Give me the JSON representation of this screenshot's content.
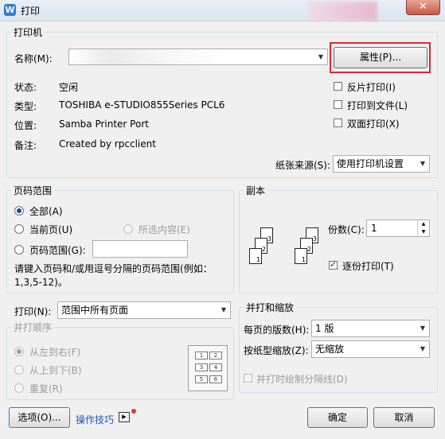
{
  "window": {
    "title": "打印",
    "close_symbol": "✕"
  },
  "printer": {
    "group_label": "打印机",
    "name_label": "名称(M):",
    "properties_button": "属性(P)...",
    "status_label": "状态:",
    "status_value": "空闲",
    "type_label": "类型:",
    "type_value": "TOSHIBA e-STUDIO855Series PCL6",
    "where_label": "位置:",
    "where_value": "Samba Printer Port",
    "comment_label": "备注:",
    "comment_value": "Created by rpcclient",
    "reverse_print": "反片打印(I)",
    "print_to_file": "打印到文件(L)",
    "duplex": "双面打印(X)",
    "paper_source_label": "纸张来源(S):",
    "paper_source_value": "使用打印机设置"
  },
  "page_range": {
    "group_label": "页码范围",
    "all": "全部(A)",
    "current": "当前页(U)",
    "selection": "所选内容(E)",
    "pages": "页码范围(G):",
    "hint": "请键入页码和/或用逗号分隔的页码范围(例如：1,3,5-12)。"
  },
  "print_what": {
    "label": "打印(N):",
    "value": "范围中所有页面"
  },
  "collate_order": {
    "group_label": "并打顺序",
    "left_to_right": "从左到右(F)",
    "top_to_bottom": "从上到下(B)",
    "repeat": "重复(R)",
    "grid_numbers": [
      "1",
      "2",
      "3",
      "4",
      "5",
      "6"
    ]
  },
  "copies": {
    "group_label": "副本",
    "count_label": "份数(C):",
    "count_value": "1",
    "collate": "逐份打印(T)",
    "page_numbers": [
      "1",
      "2",
      "3"
    ]
  },
  "zoom": {
    "group_label": "并打和缩放",
    "pages_per_sheet_label": "每页的版数(H):",
    "pages_per_sheet_value": "1 版",
    "scale_label": "按纸型缩放(Z):",
    "scale_value": "无缩放",
    "draw_borders": "并打时绘制分隔线(D)"
  },
  "footer": {
    "options_button": "选项(O)...",
    "tips_link": "操作技巧",
    "ok_button": "确定",
    "cancel_button": "取消"
  },
  "colors": {
    "highlight": "#e3262e",
    "link": "#1f58b3",
    "notify_dot": "#e53935"
  }
}
